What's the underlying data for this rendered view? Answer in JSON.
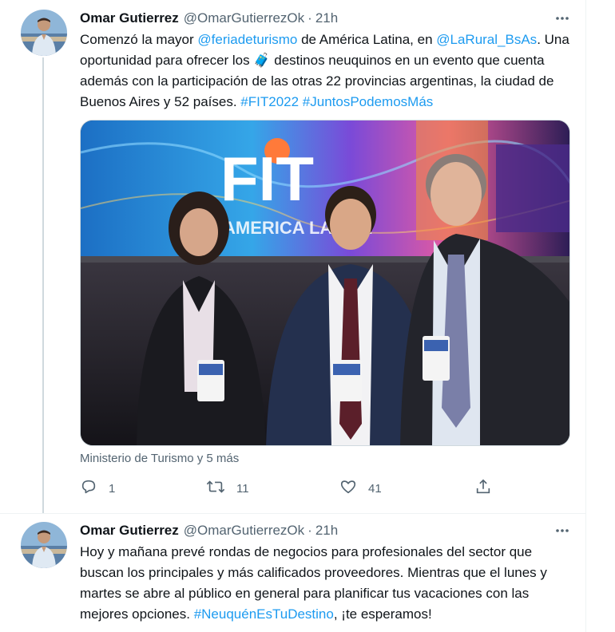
{
  "tweets": [
    {
      "author_name": "Omar Gutierrez",
      "handle": "@OmarGutierrezOk",
      "separator": "·",
      "time": "21h",
      "text_parts": [
        {
          "text": "Comenzó la mayor ",
          "link": false
        },
        {
          "text": "@feriadeturismo",
          "link": true
        },
        {
          "text": " de América Latina, en ",
          "link": false
        },
        {
          "text": "@LaRural_BsAs",
          "link": true
        },
        {
          "text": ". Una oportunidad para ofrecer los ",
          "link": false
        },
        {
          "text": "🧳",
          "link": false
        },
        {
          "text": " destinos neuquinos en un evento que cuenta además con la participación de las otras 22 provincias argentinas, la ciudad de Buenos Aires y 52 países. ",
          "link": false
        },
        {
          "text": "#FIT2022",
          "link": true
        },
        {
          "text": " ",
          "link": false
        },
        {
          "text": "#JuntosPodemosMás",
          "link": true
        }
      ],
      "media_sign_text": "FIT",
      "media_sign_subtext": "AMERICA LATINA",
      "tagged": "Ministerio de Turismo y 5 más",
      "actions": {
        "reply_count": "1",
        "retweet_count": "11",
        "like_count": "41"
      }
    },
    {
      "author_name": "Omar Gutierrez",
      "handle": "@OmarGutierrezOk",
      "separator": "·",
      "time": "21h",
      "text_parts": [
        {
          "text": "Hoy y mañana prevé rondas de negocios para profesionales del sector que buscan los principales y más calificados proveedores. Mientras que el lunes y martes se abre al público en general para planificar tus vacaciones con las mejores opciones. ",
          "link": false
        },
        {
          "text": "#NeuquénEsTuDestino",
          "link": true
        },
        {
          "text": ", ¡te esperamos!",
          "link": false
        }
      ]
    }
  ],
  "colors": {
    "link": "#1d9bf0",
    "secondary_text": "#536471",
    "primary_text": "#0f1419"
  },
  "icons": [
    "more-icon",
    "reply-icon",
    "retweet-icon",
    "like-icon",
    "share-icon"
  ]
}
